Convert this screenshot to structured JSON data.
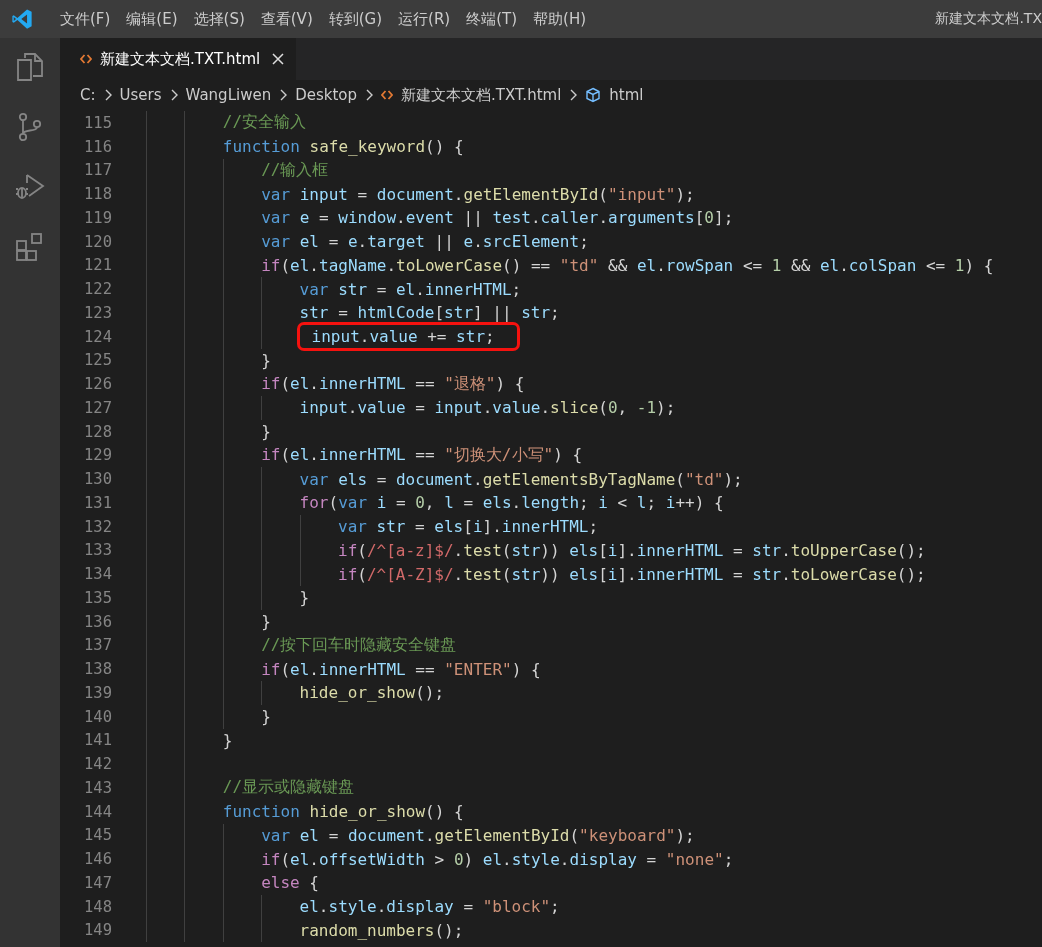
{
  "menu": [
    "文件(F)",
    "编辑(E)",
    "选择(S)",
    "查看(V)",
    "转到(G)",
    "运行(R)",
    "终端(T)",
    "帮助(H)"
  ],
  "window": {
    "title": "新建文本文档.TX"
  },
  "activity_bar": [
    {
      "kind": "files",
      "selected": false
    },
    {
      "kind": "source-control",
      "selected": false
    },
    {
      "kind": "run-debug",
      "selected": false
    },
    {
      "kind": "extensions",
      "selected": false
    }
  ],
  "tabs": [
    {
      "label": "新建文本文档.TXT.html",
      "selected": true
    }
  ],
  "breadcrumb": [
    {
      "kind": "folder",
      "label": "C:"
    },
    {
      "kind": "folder",
      "label": "Users"
    },
    {
      "kind": "folder",
      "label": "WangLiwen"
    },
    {
      "kind": "folder",
      "label": "Desktop"
    },
    {
      "kind": "file",
      "label": "新建文本文档.TXT.html"
    },
    {
      "kind": "symbol",
      "label": "html"
    }
  ],
  "code": [
    {
      "n": "115",
      "highlighted": false,
      "t": [
        {
          "kind": "comment",
          "text": "//安全输入"
        }
      ]
    },
    {
      "n": "116",
      "highlighted": false,
      "t": [
        {
          "kind": "keyword",
          "text": "function"
        },
        {
          "kind": "function",
          "text": " safe_keyword"
        },
        {
          "kind": "plain",
          "text": "() {"
        }
      ],
      "children": [
        {
          "n": "117",
          "highlighted": false,
          "t": [
            {
              "kind": "comment",
              "text": "//输入框"
            }
          ]
        },
        {
          "n": "118",
          "highlighted": false,
          "t": [
            {
              "kind": "keyword",
              "text": "var"
            },
            {
              "kind": "variable",
              "text": " input"
            },
            {
              "kind": "plain",
              "text": " = "
            },
            {
              "kind": "variable",
              "text": "document"
            },
            {
              "kind": "plain",
              "text": "."
            },
            {
              "kind": "function",
              "text": "getElementById"
            },
            {
              "kind": "plain",
              "text": "("
            },
            {
              "kind": "string",
              "text": "\"input\""
            },
            {
              "kind": "plain",
              "text": ");"
            }
          ]
        },
        {
          "n": "119",
          "highlighted": false,
          "t": [
            {
              "kind": "keyword",
              "text": "var"
            },
            {
              "kind": "variable",
              "text": " e"
            },
            {
              "kind": "plain",
              "text": " = "
            },
            {
              "kind": "variable",
              "text": "window"
            },
            {
              "kind": "plain",
              "text": "."
            },
            {
              "kind": "variable",
              "text": "event"
            },
            {
              "kind": "plain",
              "text": " || "
            },
            {
              "kind": "variable",
              "text": "test"
            },
            {
              "kind": "plain",
              "text": "."
            },
            {
              "kind": "variable",
              "text": "caller"
            },
            {
              "kind": "plain",
              "text": "."
            },
            {
              "kind": "variable",
              "text": "arguments"
            },
            {
              "kind": "plain",
              "text": "["
            },
            {
              "kind": "number",
              "text": "0"
            },
            {
              "kind": "plain",
              "text": "];"
            }
          ]
        },
        {
          "n": "120",
          "highlighted": false,
          "t": [
            {
              "kind": "keyword",
              "text": "var"
            },
            {
              "kind": "variable",
              "text": " el"
            },
            {
              "kind": "plain",
              "text": " = "
            },
            {
              "kind": "variable",
              "text": "e"
            },
            {
              "kind": "plain",
              "text": "."
            },
            {
              "kind": "variable",
              "text": "target"
            },
            {
              "kind": "plain",
              "text": " || "
            },
            {
              "kind": "variable",
              "text": "e"
            },
            {
              "kind": "plain",
              "text": "."
            },
            {
              "kind": "variable",
              "text": "srcElement"
            },
            {
              "kind": "plain",
              "text": ";"
            }
          ]
        },
        {
          "n": "121",
          "highlighted": false,
          "t": [
            {
              "kind": "control",
              "text": "if"
            },
            {
              "kind": "plain",
              "text": "("
            },
            {
              "kind": "variable",
              "text": "el"
            },
            {
              "kind": "plain",
              "text": "."
            },
            {
              "kind": "variable",
              "text": "tagName"
            },
            {
              "kind": "plain",
              "text": "."
            },
            {
              "kind": "function",
              "text": "toLowerCase"
            },
            {
              "kind": "plain",
              "text": "() == "
            },
            {
              "kind": "string",
              "text": "\"td\""
            },
            {
              "kind": "plain",
              "text": " && "
            },
            {
              "kind": "variable",
              "text": "el"
            },
            {
              "kind": "plain",
              "text": "."
            },
            {
              "kind": "variable",
              "text": "rowSpan"
            },
            {
              "kind": "plain",
              "text": " <= "
            },
            {
              "kind": "number",
              "text": "1"
            },
            {
              "kind": "plain",
              "text": " && "
            },
            {
              "kind": "variable",
              "text": "el"
            },
            {
              "kind": "plain",
              "text": "."
            },
            {
              "kind": "variable",
              "text": "colSpan"
            },
            {
              "kind": "plain",
              "text": " <= "
            },
            {
              "kind": "number",
              "text": "1"
            },
            {
              "kind": "plain",
              "text": ") {"
            }
          ],
          "children": [
            {
              "n": "122",
              "highlighted": false,
              "t": [
                {
                  "kind": "keyword",
                  "text": "var"
                },
                {
                  "kind": "variable",
                  "text": " str"
                },
                {
                  "kind": "plain",
                  "text": " = "
                },
                {
                  "kind": "variable",
                  "text": "el"
                },
                {
                  "kind": "plain",
                  "text": "."
                },
                {
                  "kind": "variable",
                  "text": "innerHTML"
                },
                {
                  "kind": "plain",
                  "text": ";"
                }
              ]
            },
            {
              "n": "123",
              "highlighted": false,
              "t": [
                {
                  "kind": "variable",
                  "text": "str"
                },
                {
                  "kind": "plain",
                  "text": " = "
                },
                {
                  "kind": "variable",
                  "text": "htmlCode"
                },
                {
                  "kind": "plain",
                  "text": "["
                },
                {
                  "kind": "variable",
                  "text": "str"
                },
                {
                  "kind": "plain",
                  "text": "] || "
                },
                {
                  "kind": "variable",
                  "text": "str"
                },
                {
                  "kind": "plain",
                  "text": ";"
                }
              ]
            },
            {
              "n": "124",
              "highlighted": true,
              "t": [
                {
                  "kind": "variable",
                  "text": "input"
                },
                {
                  "kind": "plain",
                  "text": "."
                },
                {
                  "kind": "variable",
                  "text": "value"
                },
                {
                  "kind": "plain",
                  "text": " += "
                },
                {
                  "kind": "variable",
                  "text": "str"
                },
                {
                  "kind": "plain",
                  "text": ";"
                }
              ]
            }
          ]
        },
        {
          "n": "125",
          "highlighted": false,
          "t": [
            {
              "kind": "plain",
              "text": "}"
            }
          ]
        },
        {
          "n": "126",
          "highlighted": false,
          "t": [
            {
              "kind": "control",
              "text": "if"
            },
            {
              "kind": "plain",
              "text": "("
            },
            {
              "kind": "variable",
              "text": "el"
            },
            {
              "kind": "plain",
              "text": "."
            },
            {
              "kind": "variable",
              "text": "innerHTML"
            },
            {
              "kind": "plain",
              "text": " == "
            },
            {
              "kind": "string",
              "text": "\"退格\""
            },
            {
              "kind": "plain",
              "text": ") {"
            }
          ],
          "children": [
            {
              "n": "127",
              "highlighted": false,
              "t": [
                {
                  "kind": "variable",
                  "text": "input"
                },
                {
                  "kind": "plain",
                  "text": "."
                },
                {
                  "kind": "variable",
                  "text": "value"
                },
                {
                  "kind": "plain",
                  "text": " = "
                },
                {
                  "kind": "variable",
                  "text": "input"
                },
                {
                  "kind": "plain",
                  "text": "."
                },
                {
                  "kind": "variable",
                  "text": "value"
                },
                {
                  "kind": "plain",
                  "text": "."
                },
                {
                  "kind": "function",
                  "text": "slice"
                },
                {
                  "kind": "plain",
                  "text": "("
                },
                {
                  "kind": "number",
                  "text": "0"
                },
                {
                  "kind": "plain",
                  "text": ", "
                },
                {
                  "kind": "number",
                  "text": "-1"
                },
                {
                  "kind": "plain",
                  "text": ");"
                }
              ]
            }
          ]
        },
        {
          "n": "128",
          "highlighted": false,
          "t": [
            {
              "kind": "plain",
              "text": "}"
            }
          ]
        },
        {
          "n": "129",
          "highlighted": false,
          "t": [
            {
              "kind": "control",
              "text": "if"
            },
            {
              "kind": "plain",
              "text": "("
            },
            {
              "kind": "variable",
              "text": "el"
            },
            {
              "kind": "plain",
              "text": "."
            },
            {
              "kind": "variable",
              "text": "innerHTML"
            },
            {
              "kind": "plain",
              "text": " == "
            },
            {
              "kind": "string",
              "text": "\"切换大/小写\""
            },
            {
              "kind": "plain",
              "text": ") {"
            }
          ],
          "children": [
            {
              "n": "130",
              "highlighted": false,
              "t": [
                {
                  "kind": "keyword",
                  "text": "var"
                },
                {
                  "kind": "variable",
                  "text": " els"
                },
                {
                  "kind": "plain",
                  "text": " = "
                },
                {
                  "kind": "variable",
                  "text": "document"
                },
                {
                  "kind": "plain",
                  "text": "."
                },
                {
                  "kind": "function",
                  "text": "getElementsByTagName"
                },
                {
                  "kind": "plain",
                  "text": "("
                },
                {
                  "kind": "string",
                  "text": "\"td\""
                },
                {
                  "kind": "plain",
                  "text": ");"
                }
              ]
            },
            {
              "n": "131",
              "highlighted": false,
              "t": [
                {
                  "kind": "control",
                  "text": "for"
                },
                {
                  "kind": "plain",
                  "text": "("
                },
                {
                  "kind": "keyword",
                  "text": "var"
                },
                {
                  "kind": "variable",
                  "text": " i"
                },
                {
                  "kind": "plain",
                  "text": " = "
                },
                {
                  "kind": "number",
                  "text": "0"
                },
                {
                  "kind": "plain",
                  "text": ", "
                },
                {
                  "kind": "variable",
                  "text": "l"
                },
                {
                  "kind": "plain",
                  "text": " = "
                },
                {
                  "kind": "variable",
                  "text": "els"
                },
                {
                  "kind": "plain",
                  "text": "."
                },
                {
                  "kind": "variable",
                  "text": "length"
                },
                {
                  "kind": "plain",
                  "text": "; "
                },
                {
                  "kind": "variable",
                  "text": "i"
                },
                {
                  "kind": "plain",
                  "text": " < "
                },
                {
                  "kind": "variable",
                  "text": "l"
                },
                {
                  "kind": "plain",
                  "text": "; "
                },
                {
                  "kind": "variable",
                  "text": "i"
                },
                {
                  "kind": "plain",
                  "text": "++) {"
                }
              ],
              "children": [
                {
                  "n": "132",
                  "highlighted": false,
                  "t": [
                    {
                      "kind": "keyword",
                      "text": "var"
                    },
                    {
                      "kind": "variable",
                      "text": " str"
                    },
                    {
                      "kind": "plain",
                      "text": " = "
                    },
                    {
                      "kind": "variable",
                      "text": "els"
                    },
                    {
                      "kind": "plain",
                      "text": "["
                    },
                    {
                      "kind": "variable",
                      "text": "i"
                    },
                    {
                      "kind": "plain",
                      "text": "]."
                    },
                    {
                      "kind": "variable",
                      "text": "innerHTML"
                    },
                    {
                      "kind": "plain",
                      "text": ";"
                    }
                  ]
                },
                {
                  "n": "133",
                  "highlighted": false,
                  "t": [
                    {
                      "kind": "control",
                      "text": "if"
                    },
                    {
                      "kind": "plain",
                      "text": "("
                    },
                    {
                      "kind": "regex",
                      "text": "/^[a-z]$/"
                    },
                    {
                      "kind": "plain",
                      "text": "."
                    },
                    {
                      "kind": "function",
                      "text": "test"
                    },
                    {
                      "kind": "plain",
                      "text": "("
                    },
                    {
                      "kind": "variable",
                      "text": "str"
                    },
                    {
                      "kind": "plain",
                      "text": ")) "
                    },
                    {
                      "kind": "variable",
                      "text": "els"
                    },
                    {
                      "kind": "plain",
                      "text": "["
                    },
                    {
                      "kind": "variable",
                      "text": "i"
                    },
                    {
                      "kind": "plain",
                      "text": "]."
                    },
                    {
                      "kind": "variable",
                      "text": "innerHTML"
                    },
                    {
                      "kind": "plain",
                      "text": " = "
                    },
                    {
                      "kind": "variable",
                      "text": "str"
                    },
                    {
                      "kind": "plain",
                      "text": "."
                    },
                    {
                      "kind": "function",
                      "text": "toUpperCase"
                    },
                    {
                      "kind": "plain",
                      "text": "();"
                    }
                  ]
                },
                {
                  "n": "134",
                  "highlighted": false,
                  "t": [
                    {
                      "kind": "control",
                      "text": "if"
                    },
                    {
                      "kind": "plain",
                      "text": "("
                    },
                    {
                      "kind": "regex",
                      "text": "/^[A-Z]$/"
                    },
                    {
                      "kind": "plain",
                      "text": "."
                    },
                    {
                      "kind": "function",
                      "text": "test"
                    },
                    {
                      "kind": "plain",
                      "text": "("
                    },
                    {
                      "kind": "variable",
                      "text": "str"
                    },
                    {
                      "kind": "plain",
                      "text": ")) "
                    },
                    {
                      "kind": "variable",
                      "text": "els"
                    },
                    {
                      "kind": "plain",
                      "text": "["
                    },
                    {
                      "kind": "variable",
                      "text": "i"
                    },
                    {
                      "kind": "plain",
                      "text": "]."
                    },
                    {
                      "kind": "variable",
                      "text": "innerHTML"
                    },
                    {
                      "kind": "plain",
                      "text": " = "
                    },
                    {
                      "kind": "variable",
                      "text": "str"
                    },
                    {
                      "kind": "plain",
                      "text": "."
                    },
                    {
                      "kind": "function",
                      "text": "toLowerCase"
                    },
                    {
                      "kind": "plain",
                      "text": "();"
                    }
                  ]
                }
              ]
            },
            {
              "n": "135",
              "highlighted": false,
              "t": [
                {
                  "kind": "plain",
                  "text": "}"
                }
              ]
            }
          ]
        },
        {
          "n": "136",
          "highlighted": false,
          "t": [
            {
              "kind": "plain",
              "text": "}"
            }
          ]
        },
        {
          "n": "137",
          "highlighted": false,
          "t": [
            {
              "kind": "comment",
              "text": "//按下回车时隐藏安全键盘"
            }
          ]
        },
        {
          "n": "138",
          "highlighted": false,
          "t": [
            {
              "kind": "control",
              "text": "if"
            },
            {
              "kind": "plain",
              "text": "("
            },
            {
              "kind": "variable",
              "text": "el"
            },
            {
              "kind": "plain",
              "text": "."
            },
            {
              "kind": "variable",
              "text": "innerHTML"
            },
            {
              "kind": "plain",
              "text": " == "
            },
            {
              "kind": "string",
              "text": "\"ENTER\""
            },
            {
              "kind": "plain",
              "text": ") {"
            }
          ],
          "children": [
            {
              "n": "139",
              "highlighted": false,
              "t": [
                {
                  "kind": "function",
                  "text": "hide_or_show"
                },
                {
                  "kind": "plain",
                  "text": "();"
                }
              ]
            }
          ]
        },
        {
          "n": "140",
          "highlighted": false,
          "t": [
            {
              "kind": "plain",
              "text": "}"
            }
          ]
        }
      ]
    },
    {
      "n": "141",
      "highlighted": false,
      "t": [
        {
          "kind": "plain",
          "text": "}"
        }
      ]
    },
    {
      "n": "142",
      "highlighted": false
    },
    {
      "n": "143",
      "highlighted": false,
      "t": [
        {
          "kind": "comment",
          "text": "//显示或隐藏键盘"
        }
      ]
    },
    {
      "n": "144",
      "highlighted": false,
      "t": [
        {
          "kind": "keyword",
          "text": "function"
        },
        {
          "kind": "function",
          "text": " hide_or_show"
        },
        {
          "kind": "plain",
          "text": "() {"
        }
      ],
      "children": [
        {
          "n": "145",
          "highlighted": false,
          "t": [
            {
              "kind": "keyword",
              "text": "var"
            },
            {
              "kind": "variable",
              "text": " el"
            },
            {
              "kind": "plain",
              "text": " = "
            },
            {
              "kind": "variable",
              "text": "document"
            },
            {
              "kind": "plain",
              "text": "."
            },
            {
              "kind": "function",
              "text": "getElementById"
            },
            {
              "kind": "plain",
              "text": "("
            },
            {
              "kind": "string",
              "text": "\"keyboard\""
            },
            {
              "kind": "plain",
              "text": ");"
            }
          ]
        },
        {
          "n": "146",
          "highlighted": false,
          "t": [
            {
              "kind": "control",
              "text": "if"
            },
            {
              "kind": "plain",
              "text": "("
            },
            {
              "kind": "variable",
              "text": "el"
            },
            {
              "kind": "plain",
              "text": "."
            },
            {
              "kind": "variable",
              "text": "offsetWidth"
            },
            {
              "kind": "plain",
              "text": " > "
            },
            {
              "kind": "number",
              "text": "0"
            },
            {
              "kind": "plain",
              "text": ") "
            },
            {
              "kind": "variable",
              "text": "el"
            },
            {
              "kind": "plain",
              "text": "."
            },
            {
              "kind": "variable",
              "text": "style"
            },
            {
              "kind": "plain",
              "text": "."
            },
            {
              "kind": "variable",
              "text": "display"
            },
            {
              "kind": "plain",
              "text": " = "
            },
            {
              "kind": "string",
              "text": "\"none\""
            },
            {
              "kind": "plain",
              "text": ";"
            }
          ]
        },
        {
          "n": "147",
          "highlighted": false,
          "t": [
            {
              "kind": "control",
              "text": "else"
            },
            {
              "kind": "plain",
              "text": " {"
            }
          ],
          "children": [
            {
              "n": "148",
              "highlighted": false,
              "t": [
                {
                  "kind": "variable",
                  "text": "el"
                },
                {
                  "kind": "plain",
                  "text": "."
                },
                {
                  "kind": "variable",
                  "text": "style"
                },
                {
                  "kind": "plain",
                  "text": "."
                },
                {
                  "kind": "variable",
                  "text": "display"
                },
                {
                  "kind": "plain",
                  "text": " = "
                },
                {
                  "kind": "string",
                  "text": "\"block\""
                },
                {
                  "kind": "plain",
                  "text": ";"
                }
              ]
            },
            {
              "n": "149",
              "highlighted": false,
              "t": [
                {
                  "kind": "function",
                  "text": "random_numbers"
                },
                {
                  "kind": "plain",
                  "text": "();"
                }
              ]
            }
          ]
        }
      ]
    }
  ]
}
